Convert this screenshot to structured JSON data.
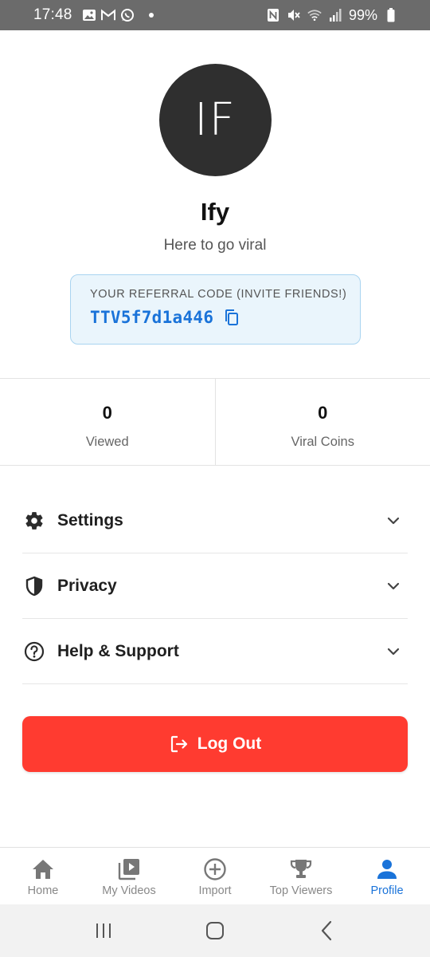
{
  "status_bar": {
    "time": "17:48",
    "battery": "99%",
    "left_icons": [
      "gallery-icon",
      "gmail-icon",
      "whatsapp-icon"
    ],
    "right_icons": [
      "nfc-icon",
      "mute-icon",
      "wifi-icon",
      "signal-icon",
      "battery-icon"
    ]
  },
  "profile": {
    "initials": "IF",
    "name": "Ify",
    "bio": "Here to go viral"
  },
  "referral": {
    "label": "YOUR REFERRAL CODE (INVITE FRIENDS!)",
    "code": "TTV5f7d1a446"
  },
  "stats": [
    {
      "value": "0",
      "label": "Viewed"
    },
    {
      "value": "0",
      "label": "Viral Coins"
    }
  ],
  "menu": [
    {
      "label": "Settings",
      "icon": "gear-icon"
    },
    {
      "label": "Privacy",
      "icon": "shield-icon"
    },
    {
      "label": "Help & Support",
      "icon": "help-icon"
    }
  ],
  "logout": {
    "label": "Log Out"
  },
  "bottom_nav": [
    {
      "label": "Home",
      "icon": "home-icon"
    },
    {
      "label": "My Videos",
      "icon": "video-library-icon"
    },
    {
      "label": "Import",
      "icon": "add-circle-icon"
    },
    {
      "label": "Top Viewers",
      "icon": "trophy-icon"
    },
    {
      "label": "Profile",
      "icon": "person-icon",
      "active": true
    }
  ],
  "colors": {
    "accent": "#1a73d9",
    "danger": "#ff3b30",
    "avatar_bg": "#2f2f2f",
    "referral_bg": "#eaf5fc",
    "referral_border": "#a9d4f0"
  }
}
